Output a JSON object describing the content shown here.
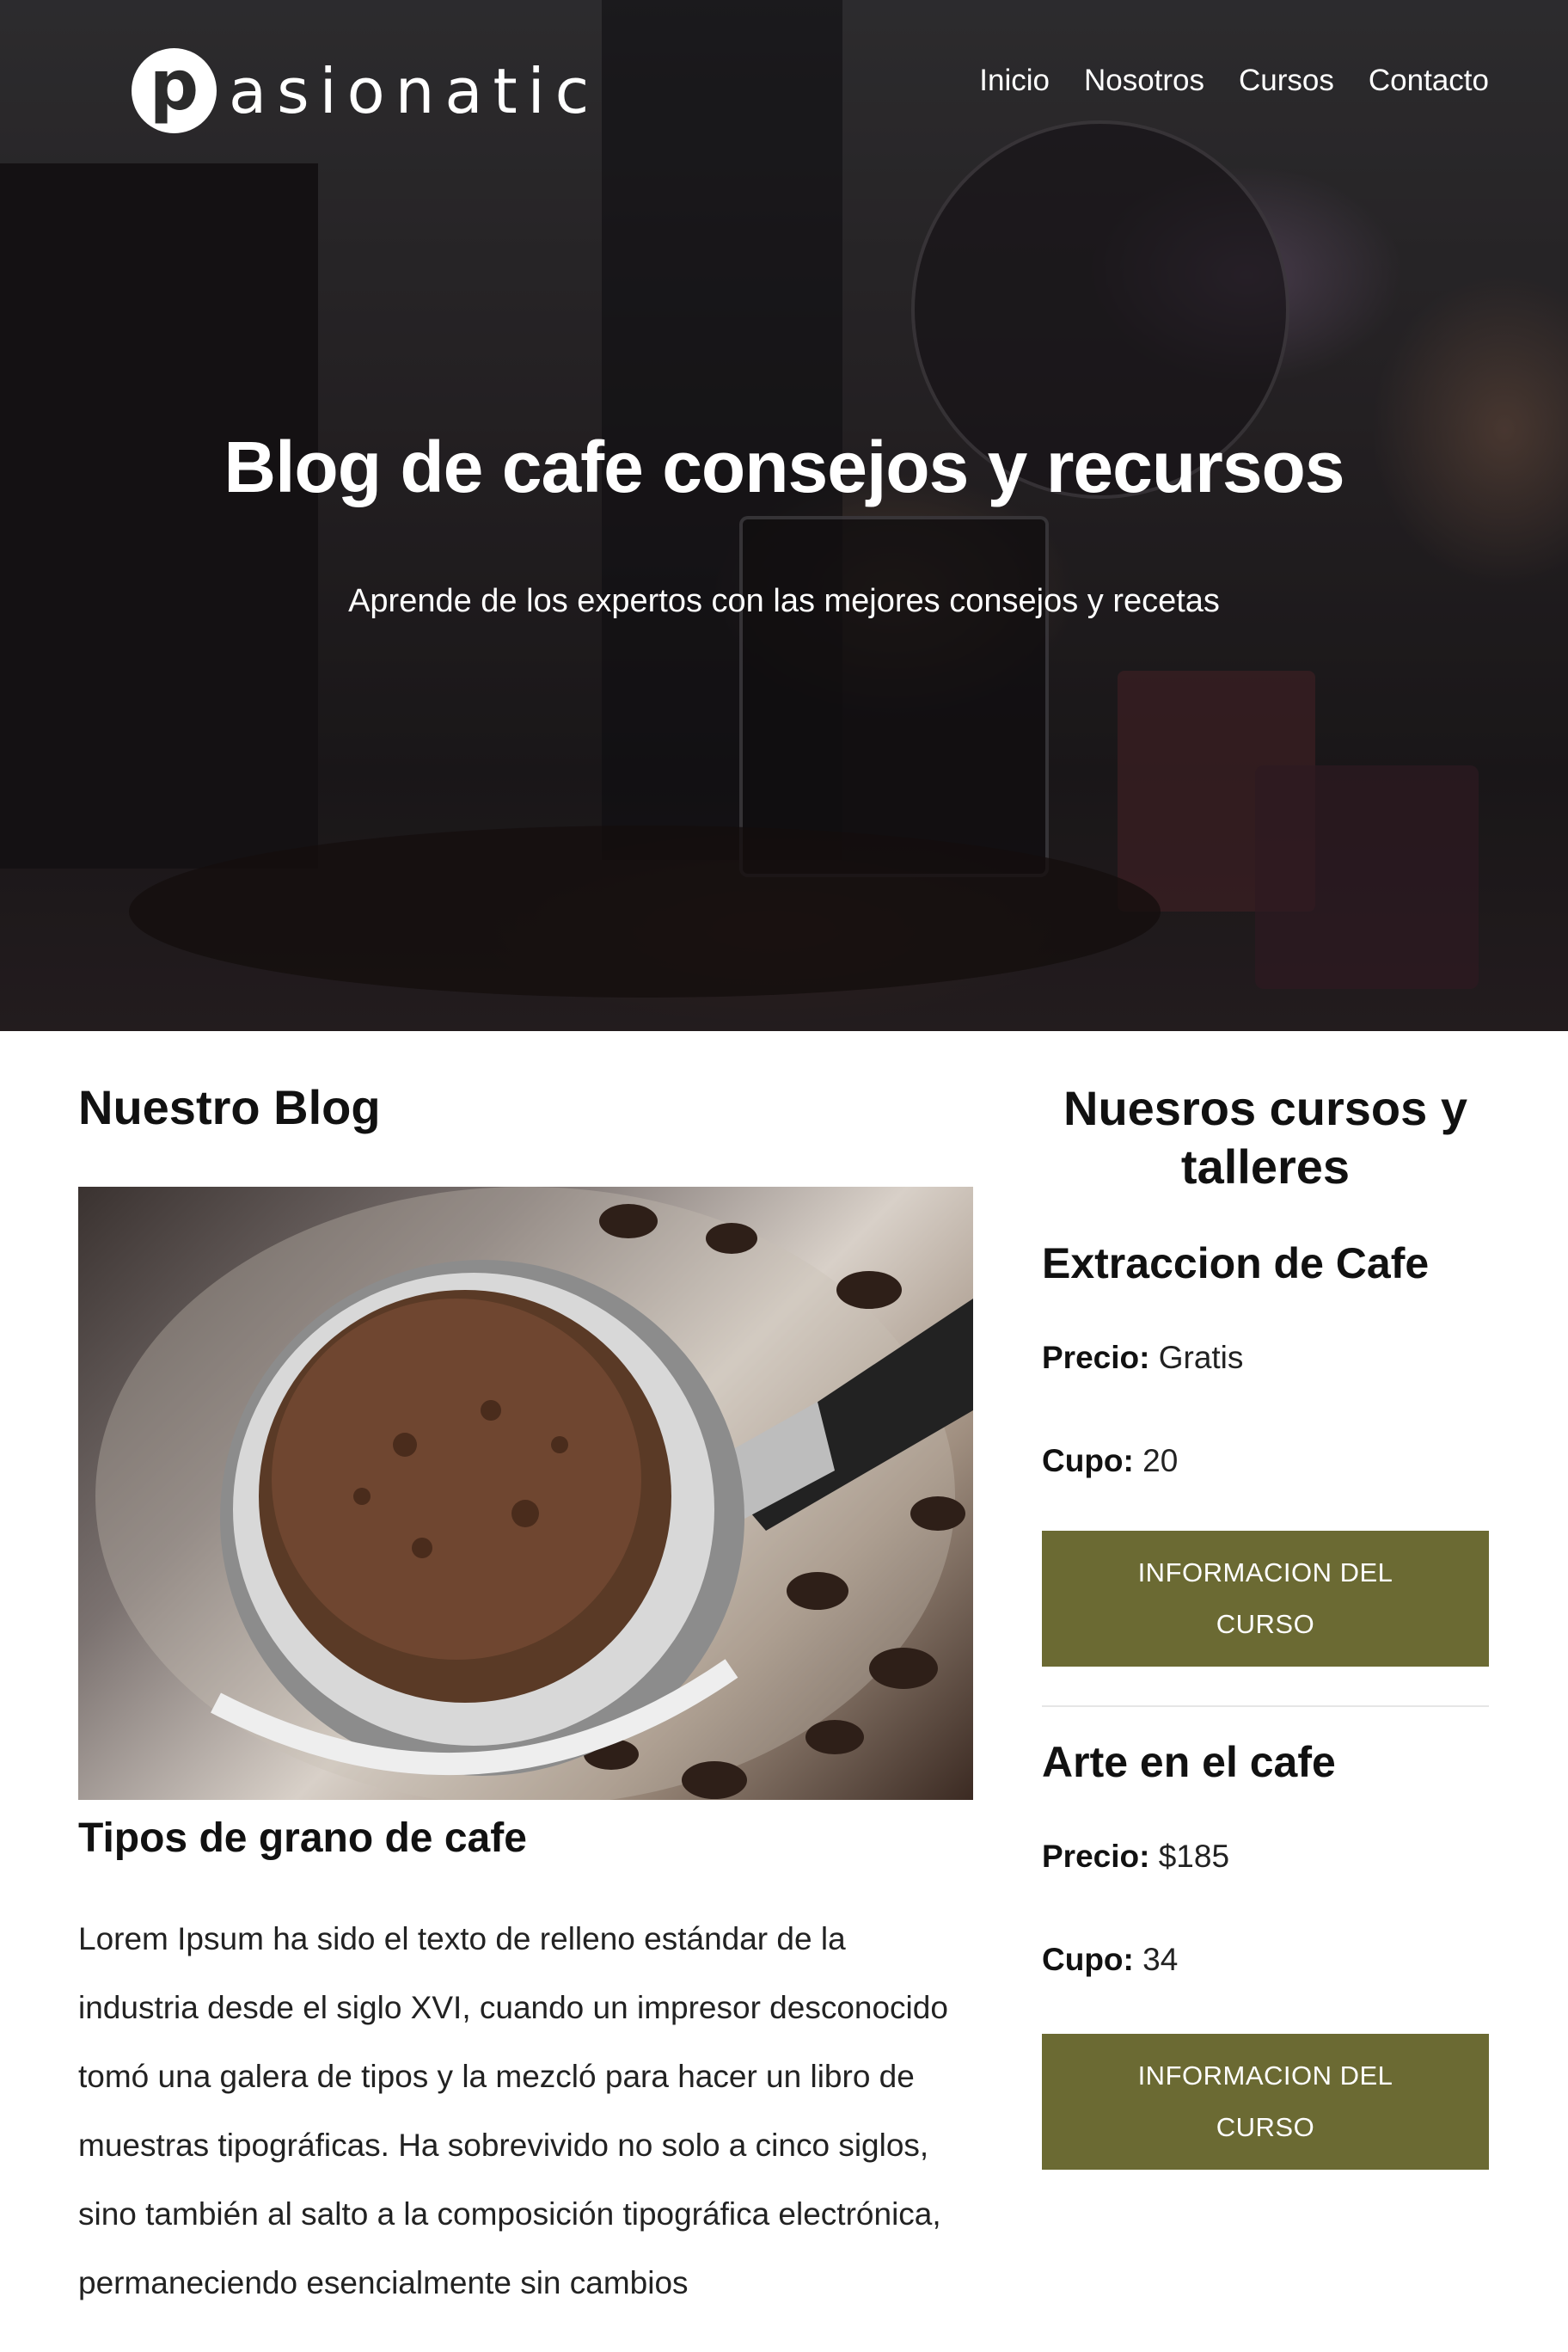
{
  "brand": {
    "logo_letter": "p",
    "name": "asionatic"
  },
  "nav": {
    "items": [
      {
        "label": "Inicio"
      },
      {
        "label": "Nosotros"
      },
      {
        "label": "Cursos"
      },
      {
        "label": "Contacto"
      }
    ]
  },
  "hero": {
    "title": "Blog de cafe consejos y recursos",
    "subtitle": "Aprende de los expertos con las mejores consejos y recetas"
  },
  "blog": {
    "heading": "Nuestro Blog",
    "post": {
      "title": "Tipos de grano de cafe",
      "body": "Lorem Ipsum ha sido el texto de relleno estándar de la industria desde el siglo XVI, cuando un impresor desconocido tomó una galera de tipos y la mezcló para hacer un libro de muestras tipográficas. Ha sobrevivido no solo a cinco siglos, sino también al salto a la composición tipográfica electrónica, permaneciendo esencialmente sin cambios"
    }
  },
  "sidebar": {
    "heading": "Nuesros cursos y talleres",
    "price_label": "Precio:",
    "seats_label": "Cupo:",
    "button_label": "INFORMACION DEL CURSO",
    "courses": [
      {
        "title": "Extraccion de Cafe",
        "price": "Gratis",
        "seats": "20"
      },
      {
        "title": "Arte en el cafe",
        "price": "$185",
        "seats": "34"
      }
    ]
  },
  "colors": {
    "button_bg": "#6b6a33",
    "hero_overlay": "#1e1c1e"
  }
}
